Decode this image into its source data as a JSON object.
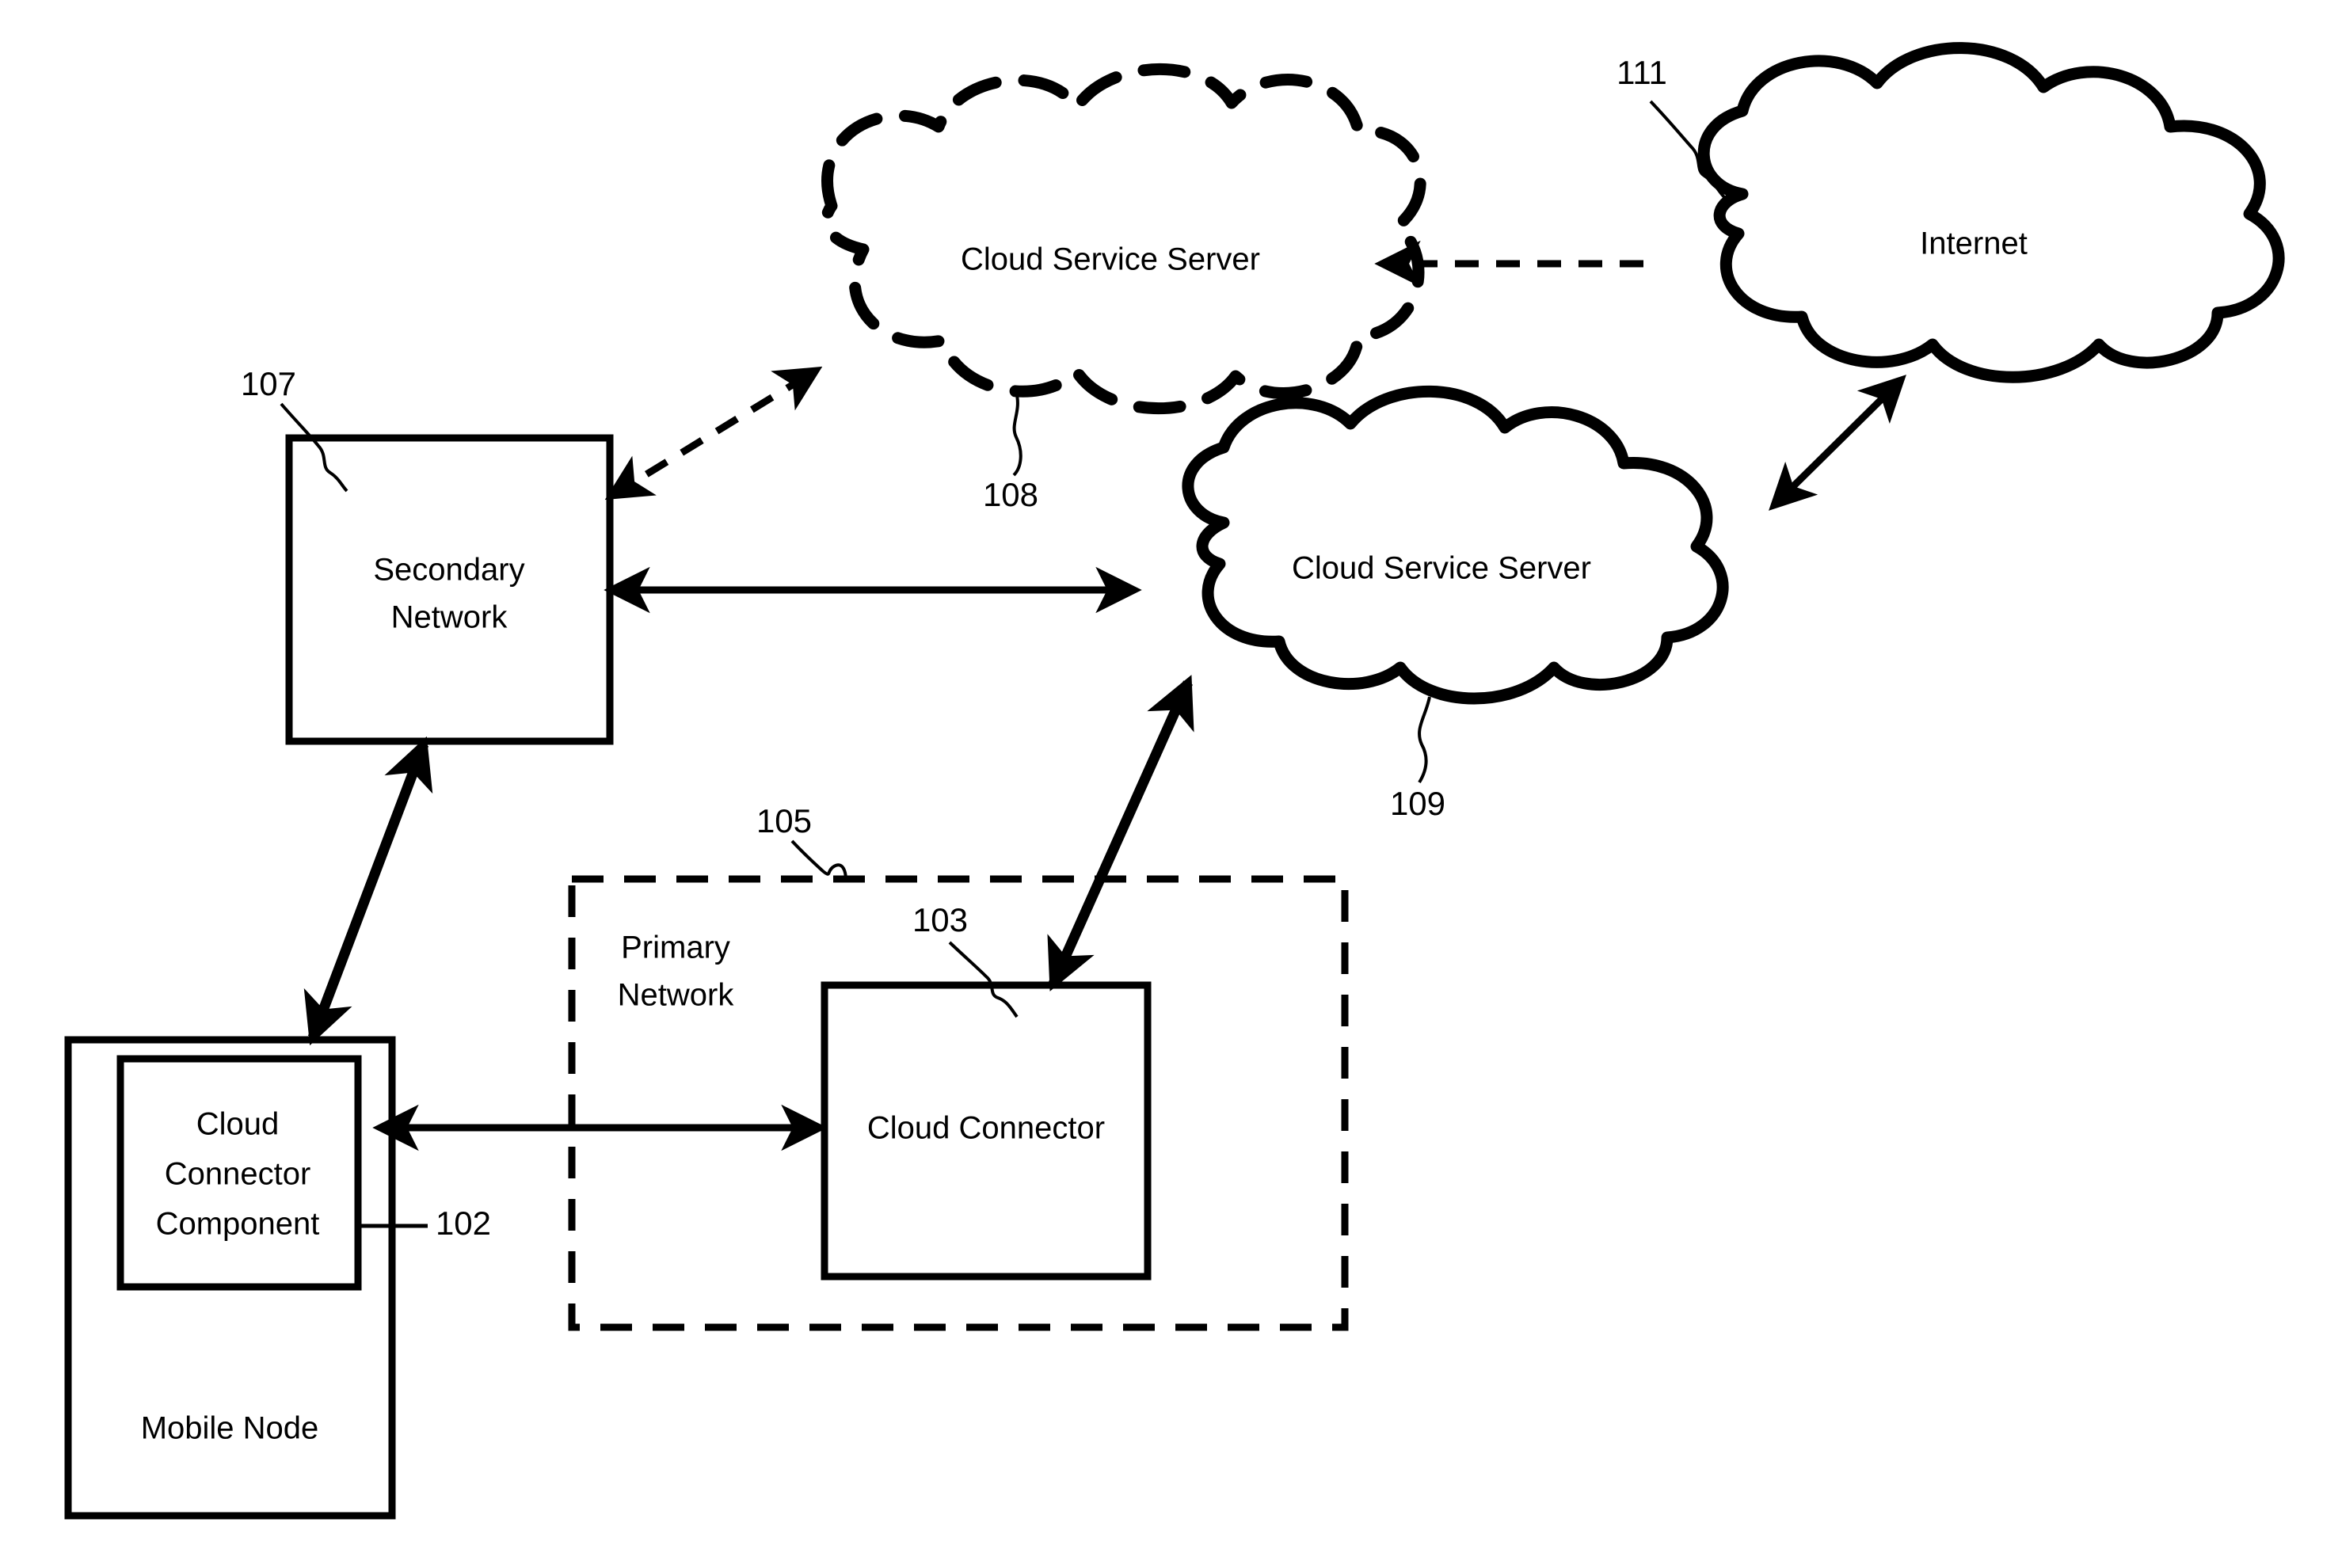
{
  "figure": {
    "type": "patent-network-diagram",
    "background_color": "#ffffff",
    "line_color": "#000000"
  },
  "nodes": {
    "cloud_service_server_dashed": {
      "label": "Cloud Service Server",
      "shape": "cloud-dashed",
      "ref": "108"
    },
    "internet": {
      "label": "Internet",
      "shape": "cloud-solid",
      "ref": "111"
    },
    "cloud_service_server_solid": {
      "label": "Cloud Service Server",
      "shape": "cloud-solid",
      "ref": "109"
    },
    "secondary_network": {
      "label_line1": "Secondary",
      "label_line2": "Network",
      "shape": "rect-solid",
      "ref": "107"
    },
    "primary_network": {
      "label_line1": "Primary",
      "label_line2": "Network",
      "shape": "rect-dashed",
      "ref": "105"
    },
    "cloud_connector": {
      "label": "Cloud Connector",
      "shape": "rect-solid",
      "ref": "103"
    },
    "mobile_node": {
      "label": "Mobile Node",
      "shape": "rect-solid"
    },
    "cloud_connector_component": {
      "label_line1": "Cloud",
      "label_line2": "Connector",
      "label_line3": "Component",
      "shape": "rect-solid",
      "ref": "102"
    }
  },
  "reference_numerals": {
    "n102": "102",
    "n103": "103",
    "n105": "105",
    "n107": "107",
    "n108": "108",
    "n109": "109",
    "n111": "111"
  },
  "connections": [
    {
      "id": "internet-to-dashed-cloud",
      "from": "internet",
      "to": "cloud_service_server_dashed",
      "style": "dashed",
      "arrows": "single"
    },
    {
      "id": "internet-to-solid-cloud",
      "from": "internet",
      "to": "cloud_service_server_solid",
      "style": "solid",
      "arrows": "double"
    },
    {
      "id": "secondary-network-to-dashed-cloud",
      "from": "secondary_network",
      "to": "cloud_service_server_dashed",
      "style": "dashed",
      "arrows": "double"
    },
    {
      "id": "secondary-network-to-solid-cloud",
      "from": "secondary_network",
      "to": "cloud_service_server_solid",
      "style": "solid",
      "arrows": "double"
    },
    {
      "id": "mobile-node-to-secondary-network",
      "from": "mobile_node",
      "to": "secondary_network",
      "style": "solid",
      "arrows": "double"
    },
    {
      "id": "cloud-connector-component-to-cloud-connector",
      "from": "cloud_connector_component",
      "to": "cloud_connector",
      "style": "solid",
      "arrows": "double"
    },
    {
      "id": "cloud-connector-to-solid-cloud",
      "from": "cloud_connector",
      "to": "cloud_service_server_solid",
      "style": "solid",
      "arrows": "double"
    }
  ]
}
